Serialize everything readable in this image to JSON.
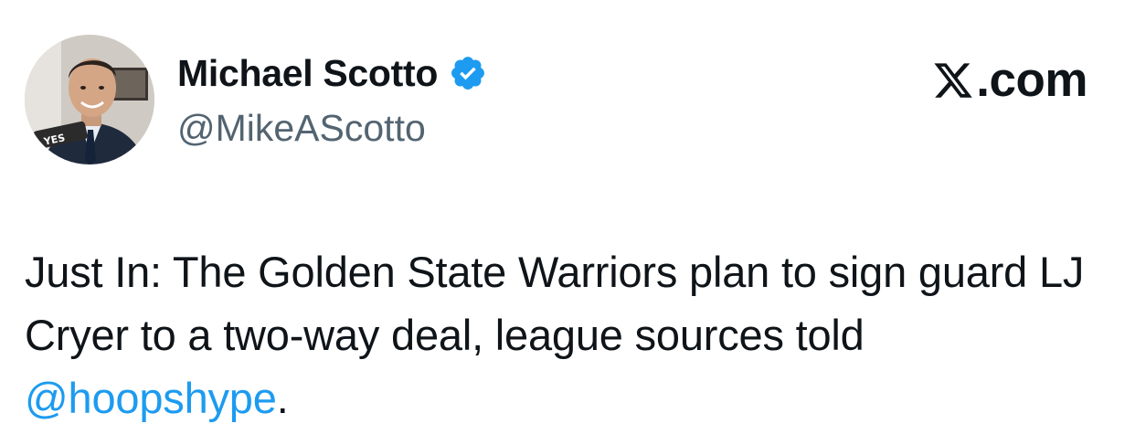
{
  "author": {
    "display_name": "Michael Scotto",
    "handle": "@MikeAScotto",
    "verified": true,
    "avatar_icon": "profile-photo",
    "avatar_text": "YES"
  },
  "brand": {
    "icon": "x-logo-icon",
    "text": ".com"
  },
  "tweet": {
    "text_before": "Just In: The Golden State Warriors plan to sign guard LJ Cryer to a two-way deal, league sources told ",
    "mention": "@hoopshype",
    "text_after": "."
  },
  "colors": {
    "text": "#0f1419",
    "secondary": "#536471",
    "accent": "#1d9bf0",
    "background": "#ffffff"
  }
}
